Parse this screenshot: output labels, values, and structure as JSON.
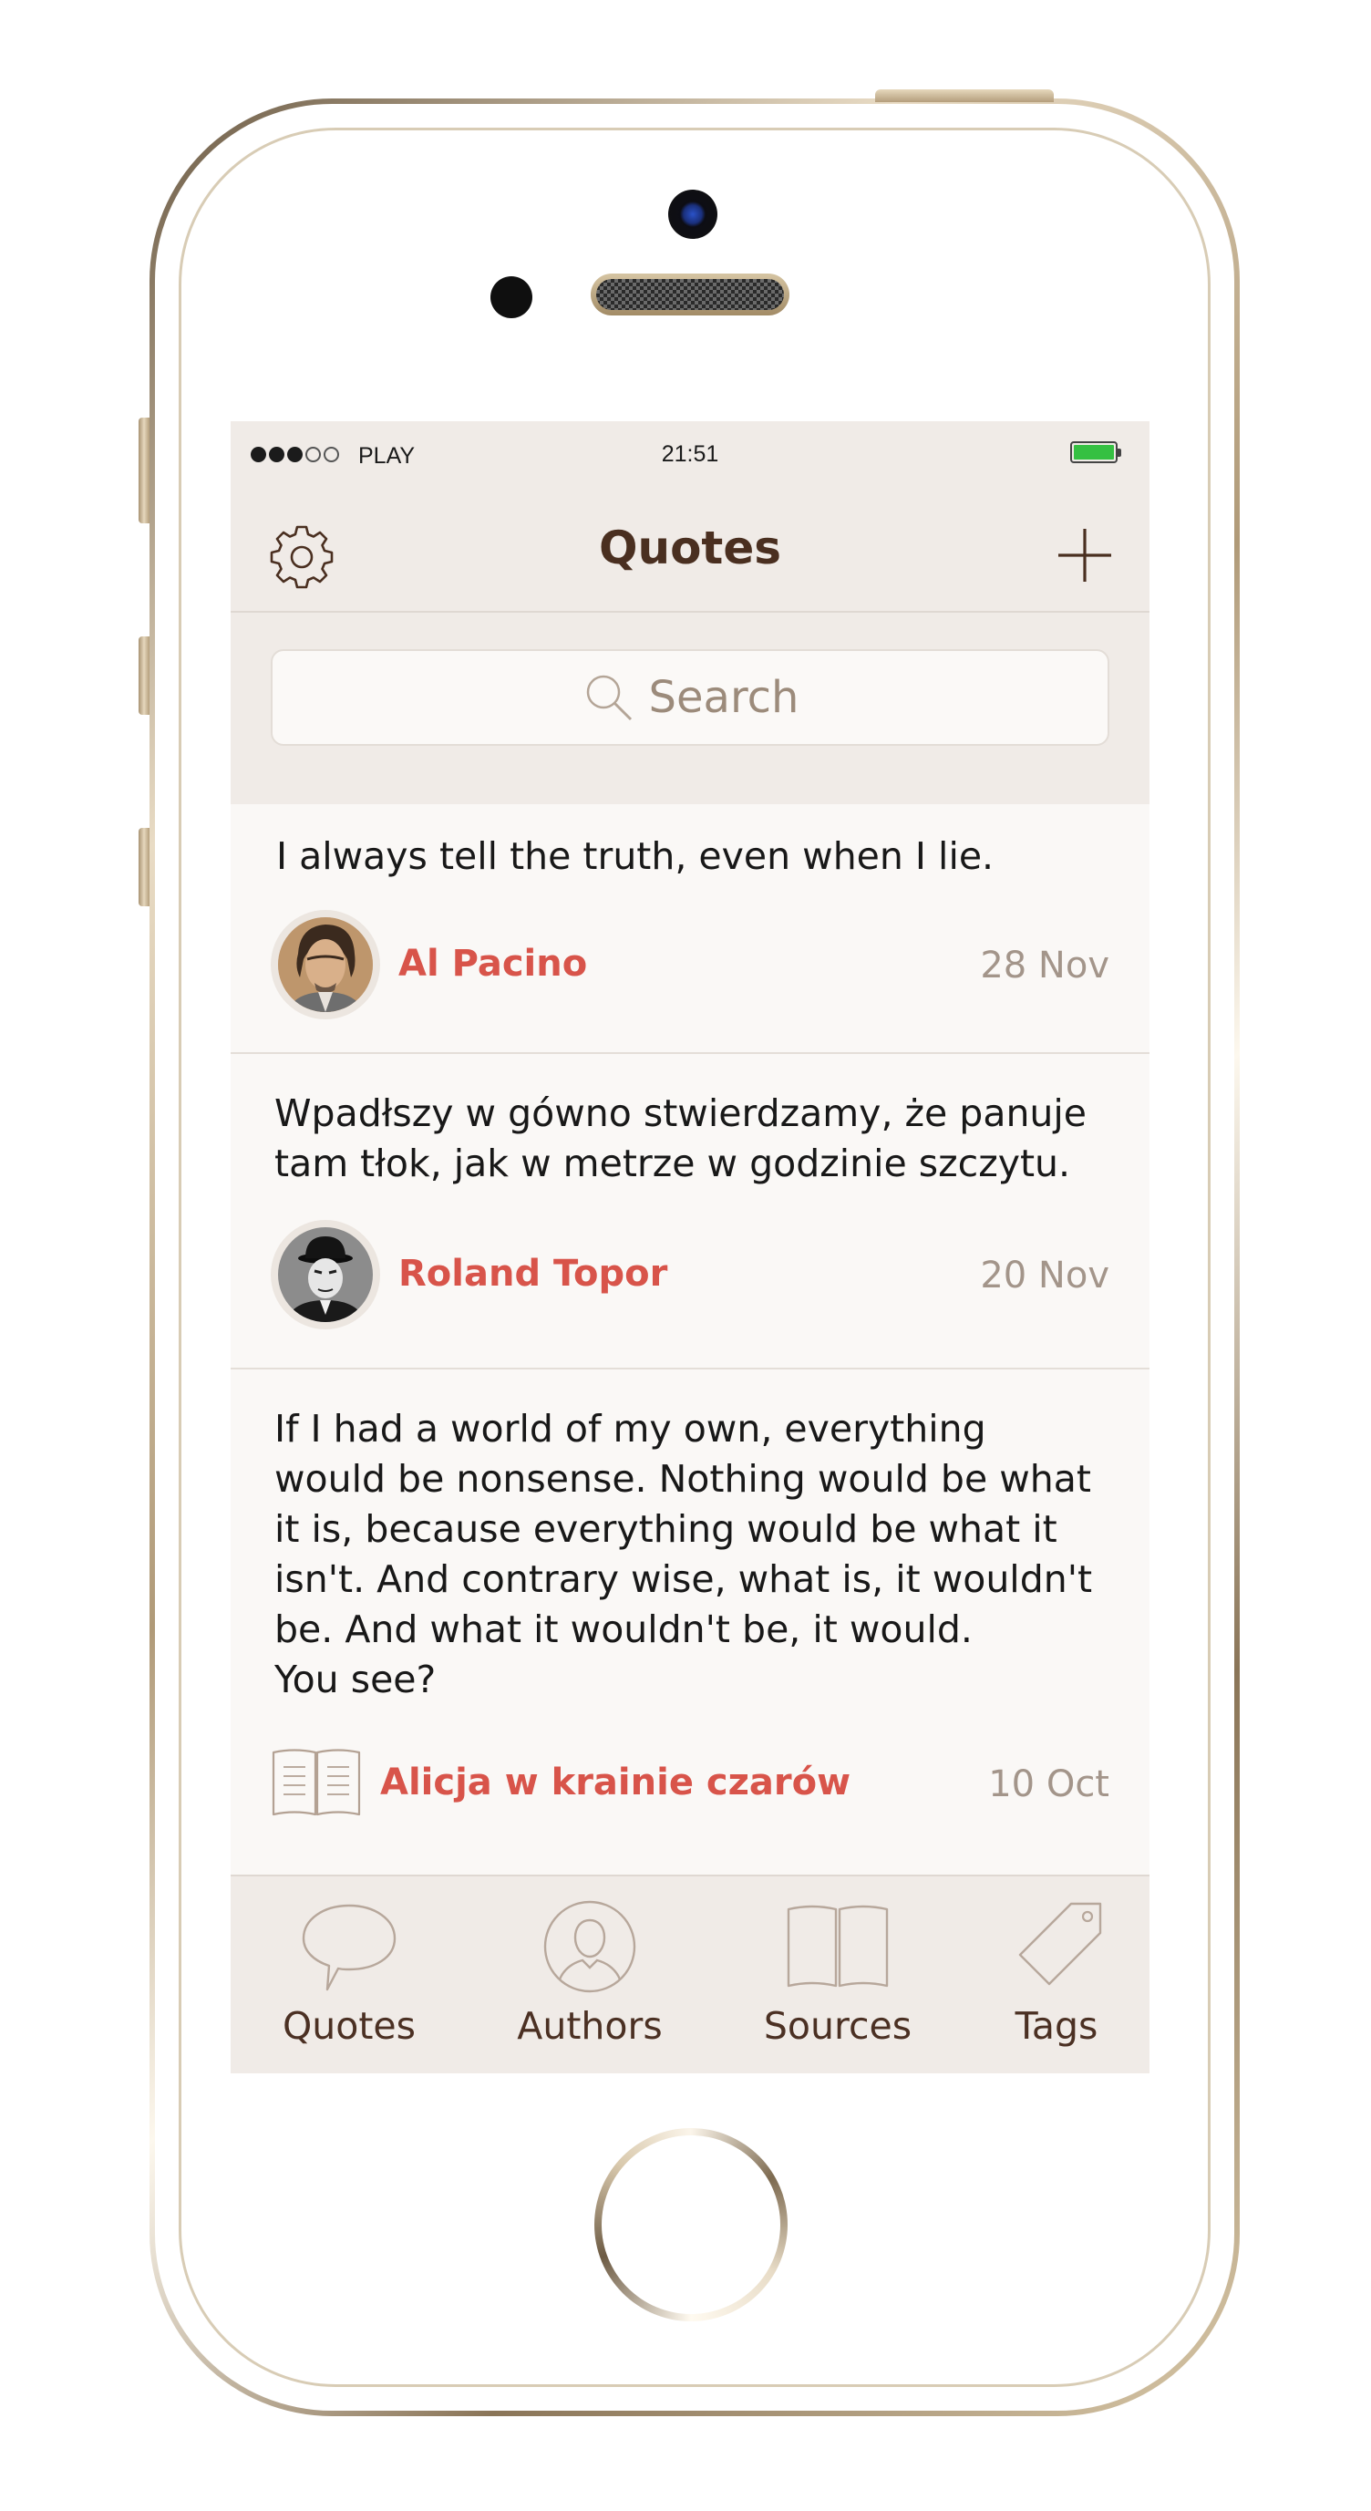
{
  "status_bar": {
    "carrier": "PLAY",
    "time": "21:51",
    "signal_bars_filled": 3,
    "signal_bars_total": 5,
    "battery_color": "#35c042"
  },
  "nav": {
    "title": "Quotes",
    "settings_icon": "gear-icon",
    "add_icon": "plus-icon"
  },
  "search": {
    "placeholder": "Search"
  },
  "quotes": [
    {
      "text": "I always tell the truth, even when I lie.",
      "author": "Al Pacino",
      "date": "28 Nov",
      "source_type": "author-photo"
    },
    {
      "text": "Wpadłszy w gówno stwierdzamy, że panuje\ntam tłok, jak w metrze w godzinie szczytu.",
      "author": "Roland Topor",
      "date": "20 Nov",
      "source_type": "author-photo"
    },
    {
      "text": "If I had a world of my own, everything\nwould be nonsense. Nothing would be what\nit is, because everything would be what it\nisn't. And contrary wise, what is, it wouldn't\nbe. And what it wouldn't be, it would.\nYou see?",
      "author": "Alicja w krainie czarów",
      "date": "10 Oct",
      "source_type": "book-icon"
    }
  ],
  "tabs": [
    {
      "label": "Quotes",
      "icon": "speech-bubble-icon"
    },
    {
      "label": "Authors",
      "icon": "person-icon"
    },
    {
      "label": "Sources",
      "icon": "book-icon"
    },
    {
      "label": "Tags",
      "icon": "tag-icon"
    }
  ],
  "colors": {
    "accent": "#d8544a",
    "title": "#4a2f20",
    "date": "#a3958a",
    "bar_background": "#f0ebe7",
    "card_background": "#faf8f6"
  }
}
